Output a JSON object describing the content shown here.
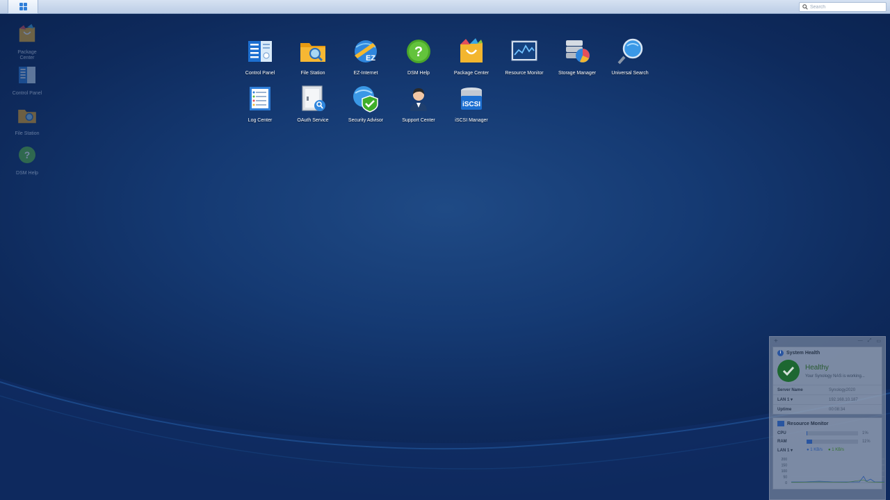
{
  "taskbar": {
    "search_placeholder": "Search"
  },
  "desktop_shortcuts": [
    {
      "label": "Package Center",
      "icon": "package-center-icon"
    },
    {
      "label": "Control Panel",
      "icon": "control-panel-icon"
    },
    {
      "label": "File Station",
      "icon": "file-station-icon"
    },
    {
      "label": "DSM Help",
      "icon": "dsm-help-icon"
    }
  ],
  "main_menu": {
    "apps": [
      {
        "label": "Control Panel",
        "icon": "control-panel-icon"
      },
      {
        "label": "File Station",
        "icon": "file-station-icon"
      },
      {
        "label": "EZ-Internet",
        "icon": "ez-internet-icon"
      },
      {
        "label": "DSM Help",
        "icon": "dsm-help-icon"
      },
      {
        "label": "Package Center",
        "icon": "package-center-icon"
      },
      {
        "label": "Resource Monitor",
        "icon": "resource-monitor-icon"
      },
      {
        "label": "Storage Manager",
        "icon": "storage-manager-icon"
      },
      {
        "label": "Universal Search",
        "icon": "universal-search-icon"
      },
      {
        "label": "Log Center",
        "icon": "log-center-icon"
      },
      {
        "label": "OAuth Service",
        "icon": "oauth-service-icon"
      },
      {
        "label": "Security Advisor",
        "icon": "security-advisor-icon"
      },
      {
        "label": "Support Center",
        "icon": "support-center-icon"
      },
      {
        "label": "iSCSI Manager",
        "icon": "iscsi-manager-icon"
      }
    ]
  },
  "widgets": {
    "system_health": {
      "title": "System Health",
      "status": "Healthy",
      "description": "Your Synology NAS is working...",
      "rows": [
        {
          "key": "Server Name",
          "value": "Synology2020"
        },
        {
          "key": "LAN 1 ▾",
          "value": "192.168.10.187"
        },
        {
          "key": "Uptime",
          "value": "00:08:34"
        }
      ]
    },
    "resource_monitor": {
      "title": "Resource Monitor",
      "cpu_label": "CPU",
      "cpu_value": "1%",
      "cpu_fraction": 0.01,
      "ram_label": "RAM",
      "ram_value": "11%",
      "ram_fraction": 0.11,
      "lan_label": "LAN 1 ▾",
      "lan_up": "1 KB/s",
      "lan_down": "1 KB/s",
      "chart_ticks": [
        "200",
        "150",
        "100",
        "50",
        "0"
      ]
    }
  },
  "colors": {
    "desktop": "#0e2a5c",
    "accent": "#2f7ed8",
    "healthy": "#1f6e2d"
  }
}
